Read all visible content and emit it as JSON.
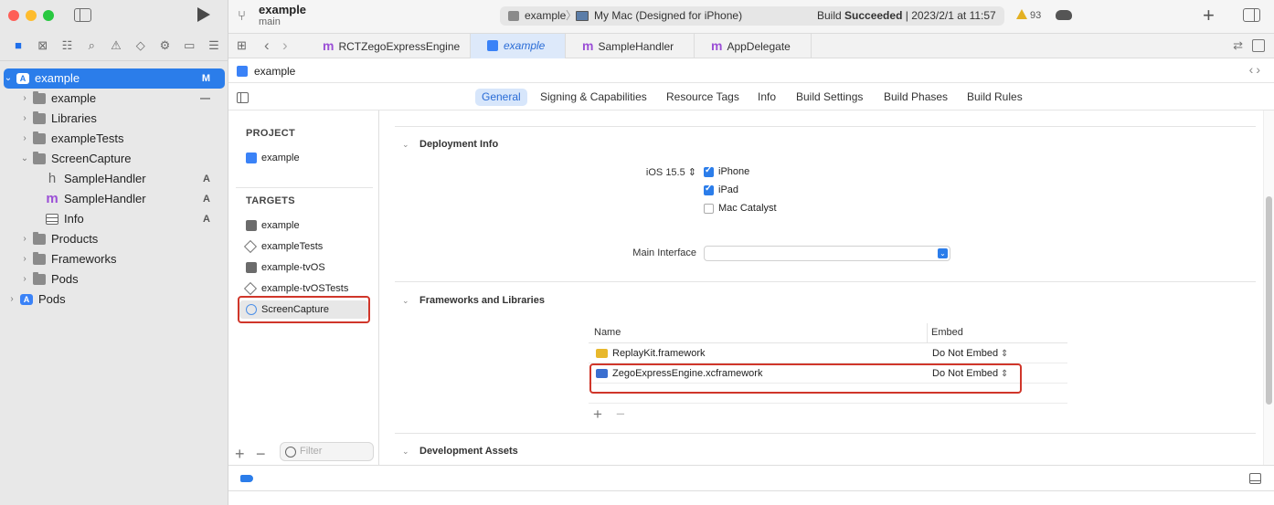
{
  "toolbar": {
    "project_name": "example",
    "branch": "main",
    "scheme": "example",
    "destination": "My Mac (Designed for iPhone)",
    "build_prefix": "Build ",
    "build_status": "Succeeded",
    "build_suffix": " | 2023/2/1 at 11:57",
    "warning_count": "93"
  },
  "navigator": {
    "tree": [
      {
        "label": "example",
        "badge": "M",
        "level": 0,
        "type": "project",
        "disclosure": "⌄",
        "selected": true
      },
      {
        "label": "example",
        "badge": "—",
        "level": 1,
        "type": "folder",
        "disclosure": "›"
      },
      {
        "label": "Libraries",
        "badge": "",
        "level": 1,
        "type": "folder",
        "disclosure": "›"
      },
      {
        "label": "exampleTests",
        "badge": "",
        "level": 1,
        "type": "folder",
        "disclosure": "›"
      },
      {
        "label": "ScreenCapture",
        "badge": "",
        "level": 1,
        "type": "folder",
        "disclosure": "⌄"
      },
      {
        "label": "SampleHandler",
        "badge": "A",
        "level": 2,
        "type": "h",
        "disclosure": ""
      },
      {
        "label": "SampleHandler",
        "badge": "A",
        "level": 2,
        "type": "m",
        "disclosure": ""
      },
      {
        "label": "Info",
        "badge": "A",
        "level": 2,
        "type": "plist",
        "disclosure": ""
      },
      {
        "label": "Products",
        "badge": "",
        "level": 1,
        "type": "folder",
        "disclosure": "›"
      },
      {
        "label": "Frameworks",
        "badge": "",
        "level": 1,
        "type": "folder",
        "disclosure": "›"
      },
      {
        "label": "Pods",
        "badge": "",
        "level": 1,
        "type": "folder",
        "disclosure": "›"
      },
      {
        "label": "Pods",
        "badge": "",
        "level": 0,
        "type": "project",
        "disclosure": "›"
      }
    ]
  },
  "editor_tabs": [
    {
      "label": "RCTZegoExpressEngine",
      "icon": "m",
      "active": false
    },
    {
      "label": "example",
      "icon": "project",
      "active": true
    },
    {
      "label": "SampleHandler",
      "icon": "m",
      "active": false
    },
    {
      "label": "AppDelegate",
      "icon": "m",
      "active": false
    }
  ],
  "breadcrumb": "example",
  "settings_tabs": [
    "General",
    "Signing & Capabilities",
    "Resource Tags",
    "Info",
    "Build Settings",
    "Build Phases",
    "Build Rules"
  ],
  "targets_panel": {
    "project_title": "PROJECT",
    "project_item": "example",
    "targets_title": "TARGETS",
    "targets": [
      {
        "label": "example",
        "icon": "app"
      },
      {
        "label": "exampleTests",
        "icon": "test"
      },
      {
        "label": "example-tvOS",
        "icon": "app"
      },
      {
        "label": "example-tvOSTests",
        "icon": "test"
      },
      {
        "label": "ScreenCapture",
        "icon": "extension",
        "selected": true
      }
    ],
    "filter_placeholder": "Filter"
  },
  "deployment": {
    "title": "Deployment Info",
    "ios_version": "iOS 15.5 ⇕",
    "devices": [
      {
        "label": "iPhone",
        "checked": true
      },
      {
        "label": "iPad",
        "checked": true
      },
      {
        "label": "Mac Catalyst",
        "checked": false
      }
    ],
    "main_interface_label": "Main Interface",
    "main_interface_value": ""
  },
  "frameworks": {
    "title": "Frameworks and Libraries",
    "col_name": "Name",
    "col_embed": "Embed",
    "rows": [
      {
        "name": "ReplayKit.framework",
        "embed": "Do Not Embed",
        "color": "#e8b82c"
      },
      {
        "name": "ZegoExpressEngine.xcframework",
        "embed": "Do Not Embed",
        "color": "#3a6fd0"
      }
    ]
  },
  "dev_assets_title": "Development Assets",
  "colors": {
    "accent": "#2b7dea",
    "highlight": "#d0362a"
  }
}
